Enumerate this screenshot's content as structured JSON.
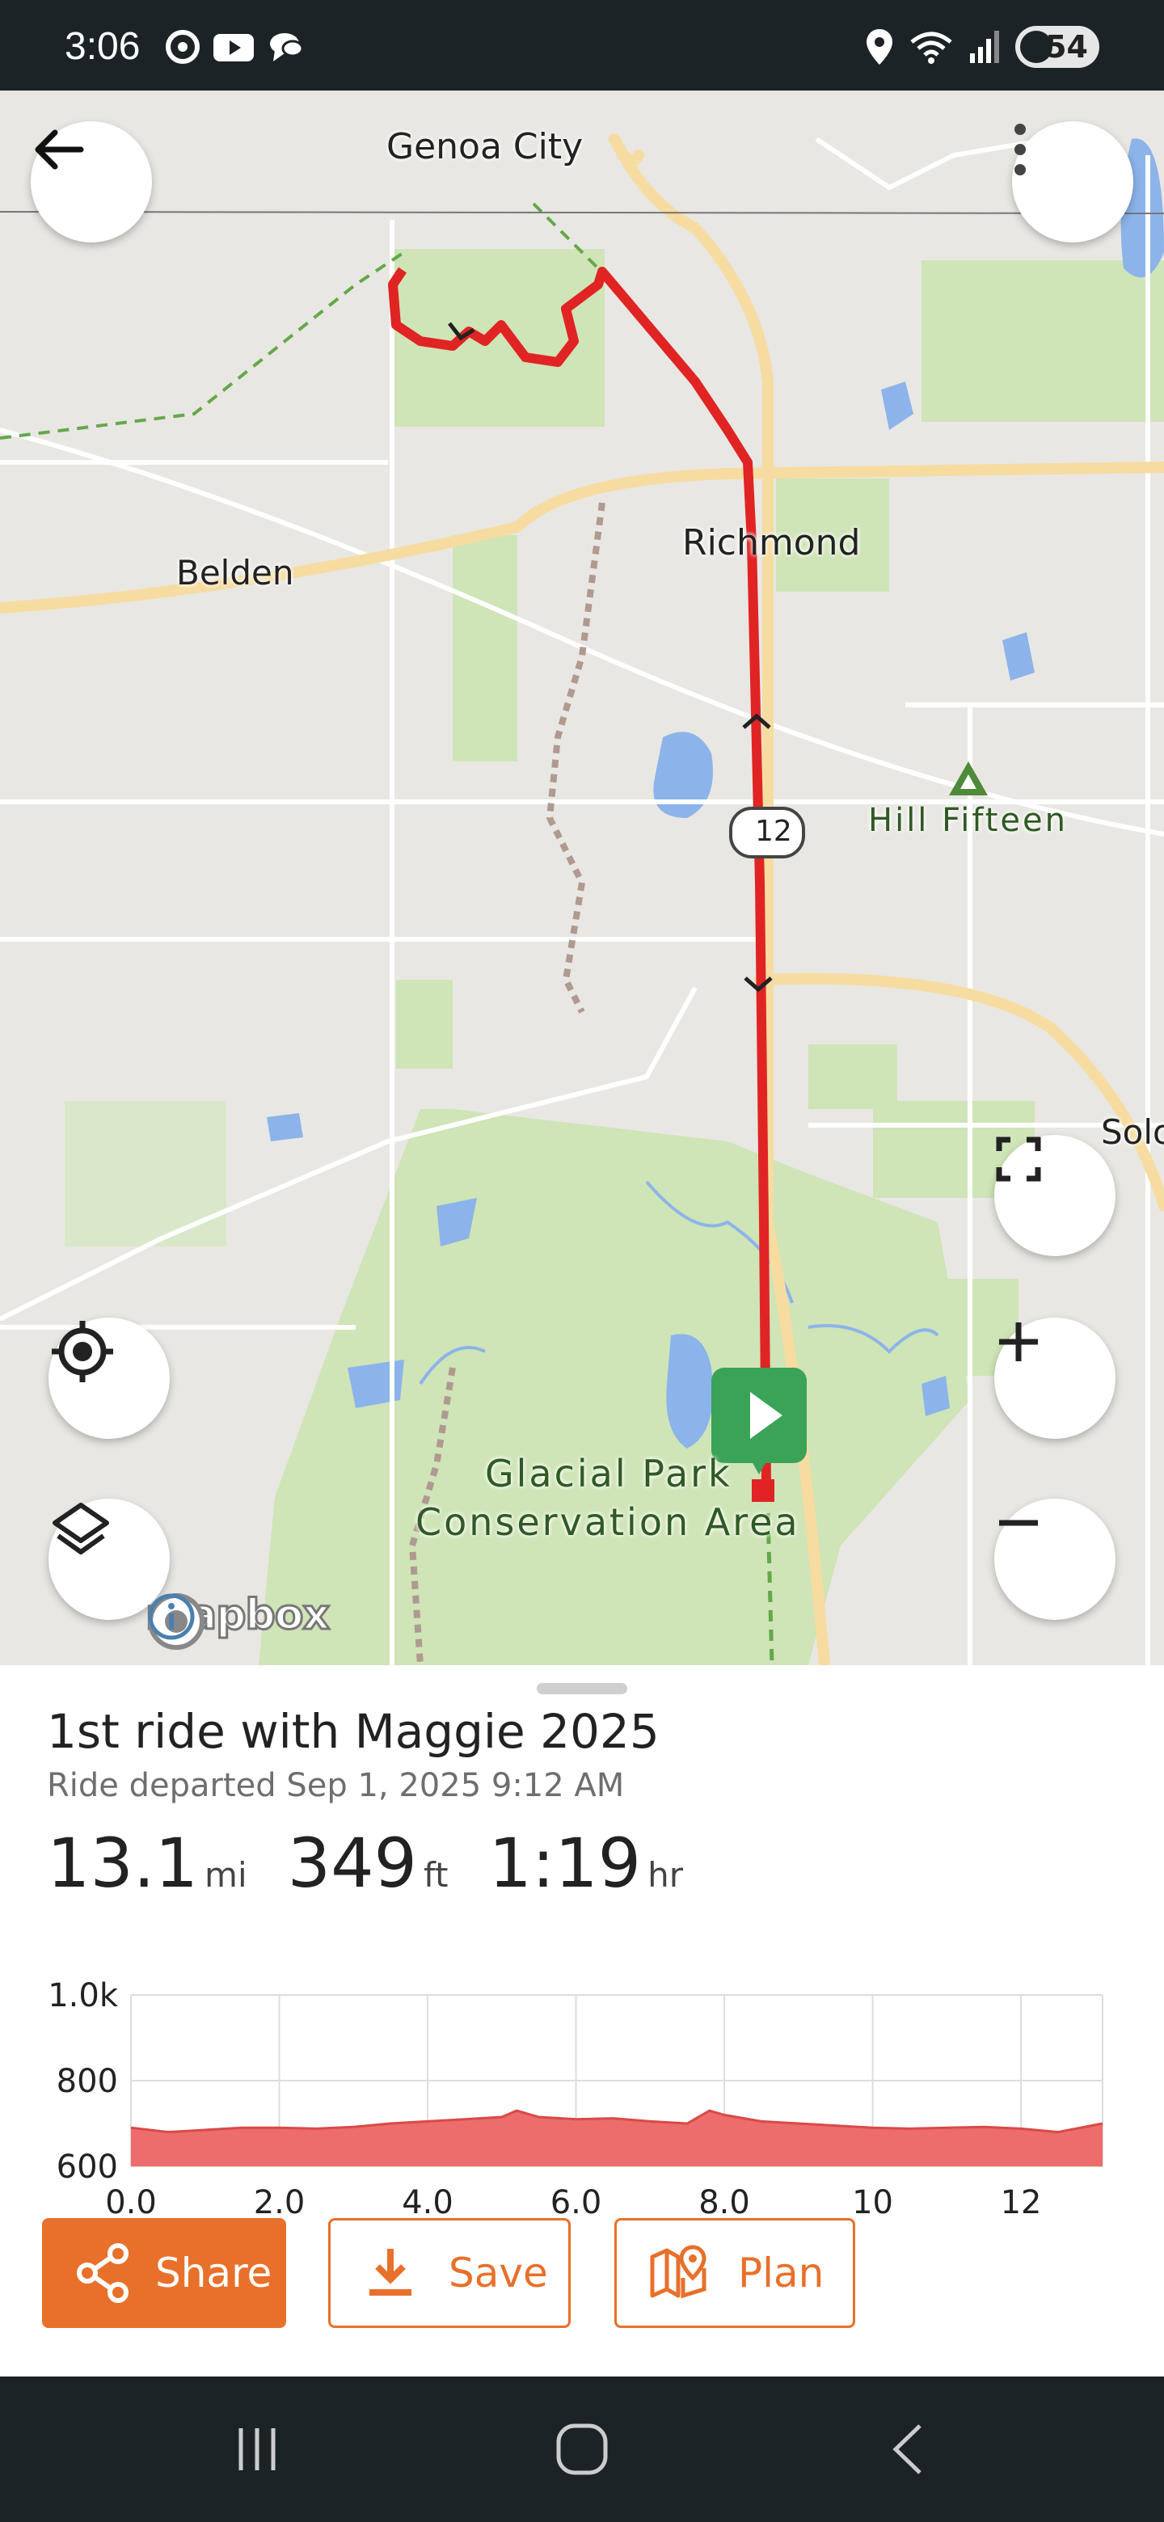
{
  "status": {
    "time": "3:06",
    "battery": "54",
    "network": "6E"
  },
  "map": {
    "labels": {
      "genoa_city": "Genoa City",
      "richmond": "Richmond",
      "belden": "Belden",
      "hill_fifteen": "Hill Fifteen",
      "solon": "Solo",
      "glacial_park_1": "Glacial Park",
      "glacial_park_2": "Conservation Area",
      "route_shield": "12"
    },
    "attribution": "mapbox",
    "route_color": "#e02424",
    "start_marker_color": "#3aa357"
  },
  "ride": {
    "title": "1st ride with Maggie 2025",
    "subtitle": "Ride departed Sep 1, 2025 9:12 AM",
    "distance_value": "13.1",
    "distance_unit": "mi",
    "elevation_value": "349",
    "elevation_unit": "ft",
    "duration_value": "1:19",
    "duration_unit": "hr"
  },
  "chart_data": {
    "type": "area",
    "x": [
      0,
      0.5,
      1,
      1.5,
      2,
      2.5,
      3,
      3.5,
      4,
      4.5,
      5,
      5.2,
      5.5,
      6,
      6.5,
      7,
      7.5,
      7.8,
      8,
      8.5,
      9,
      9.5,
      10,
      10.5,
      11,
      11.5,
      12,
      12.5,
      13.1
    ],
    "y": [
      690,
      680,
      685,
      690,
      690,
      688,
      692,
      700,
      705,
      710,
      715,
      730,
      715,
      710,
      712,
      705,
      700,
      730,
      720,
      705,
      700,
      695,
      690,
      688,
      690,
      692,
      688,
      680,
      700
    ],
    "x_ticks": [
      "0.0",
      "2.0",
      "4.0",
      "6.0",
      "8.0",
      "10",
      "12"
    ],
    "y_ticks": [
      "1.0k",
      "800",
      "600"
    ],
    "xlim": [
      0,
      13.1
    ],
    "ylim": [
      600,
      1000
    ],
    "fill_color": "#ec6d6b",
    "line_color": "#d84a48",
    "grid": true
  },
  "actions": {
    "share": "Share",
    "save": "Save",
    "plan": "Plan"
  },
  "colors": {
    "accent": "#e8702a"
  }
}
